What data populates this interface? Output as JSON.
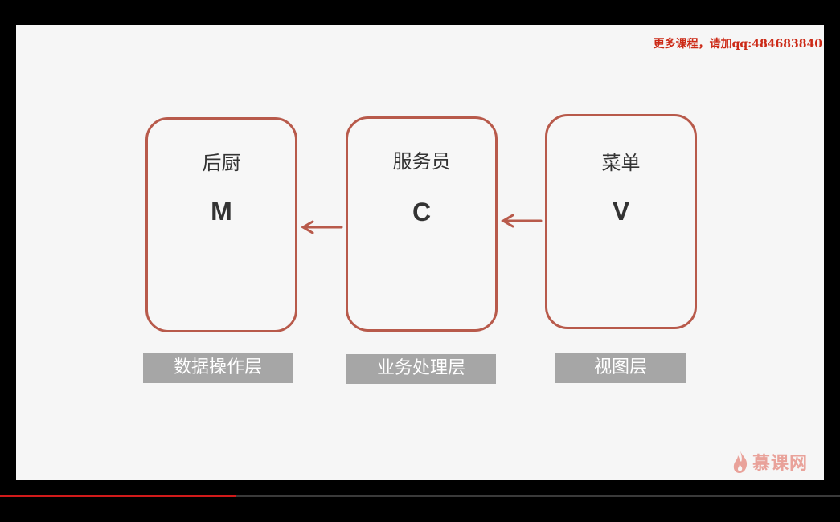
{
  "watermark": "更多课程，请加qq:484683840",
  "cards": [
    {
      "title": "后厨",
      "letter": "M",
      "layer": "数据操作层"
    },
    {
      "title": "服务员",
      "letter": "C",
      "layer": "业务处理层"
    },
    {
      "title": "菜单",
      "letter": "V",
      "layer": "视图层"
    }
  ],
  "logo": {
    "text": "慕课网",
    "icon": "flame-icon"
  },
  "video": {
    "progress": 0.28
  },
  "colors": {
    "border": "#b85a4b",
    "label_bg": "#a6a6a6",
    "watermark": "#cc2a17",
    "logo": "#e9a29a",
    "progress": "#d11a1a"
  }
}
